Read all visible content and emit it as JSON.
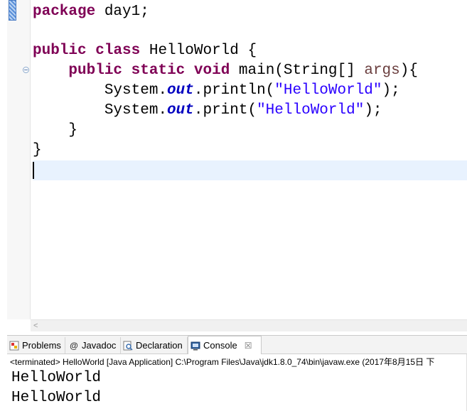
{
  "editor": {
    "lines": {
      "l1": {
        "kw": "package",
        "rest": " day1;"
      },
      "l3": {
        "kw1": "public",
        "kw2": "class",
        "rest": " HelloWorld {"
      },
      "l4": {
        "indent": "    ",
        "kw1": "public",
        "kw2": "static",
        "kw3": "void",
        "name": " main(String[] ",
        "arg": "args",
        "end": "){"
      },
      "l5": {
        "indent": "        ",
        "obj": "System.",
        "field": "out",
        "call": ".println(",
        "str": "\"HelloWorld\"",
        "end": ");"
      },
      "l6": {
        "indent": "        ",
        "obj": "System.",
        "field": "out",
        "call": ".print(",
        "str": "\"HelloWorld\"",
        "end": ");"
      },
      "l7": {
        "text": "    }"
      },
      "l8": {
        "text": "}"
      }
    },
    "scroll_arrow": "<"
  },
  "views": {
    "tabs": [
      {
        "label": "Problems"
      },
      {
        "label": "Javadoc"
      },
      {
        "label": "Declaration"
      },
      {
        "label": "Console",
        "close": "☒"
      }
    ],
    "console": {
      "header": "<terminated> HelloWorld [Java Application] C:\\Program Files\\Java\\jdk1.8.0_74\\bin\\javaw.exe (2017年8月15日 下",
      "output": [
        "HelloWorld",
        "HelloWorld"
      ]
    }
  },
  "colors": {
    "keyword": "#7f0055",
    "field": "#0000c0",
    "string": "#2a00ff",
    "current_line": "#e8f2fe"
  },
  "icons": [
    "problems-icon",
    "javadoc-at-icon",
    "declaration-icon",
    "console-icon",
    "close-icon",
    "fold-collapse-icon"
  ]
}
